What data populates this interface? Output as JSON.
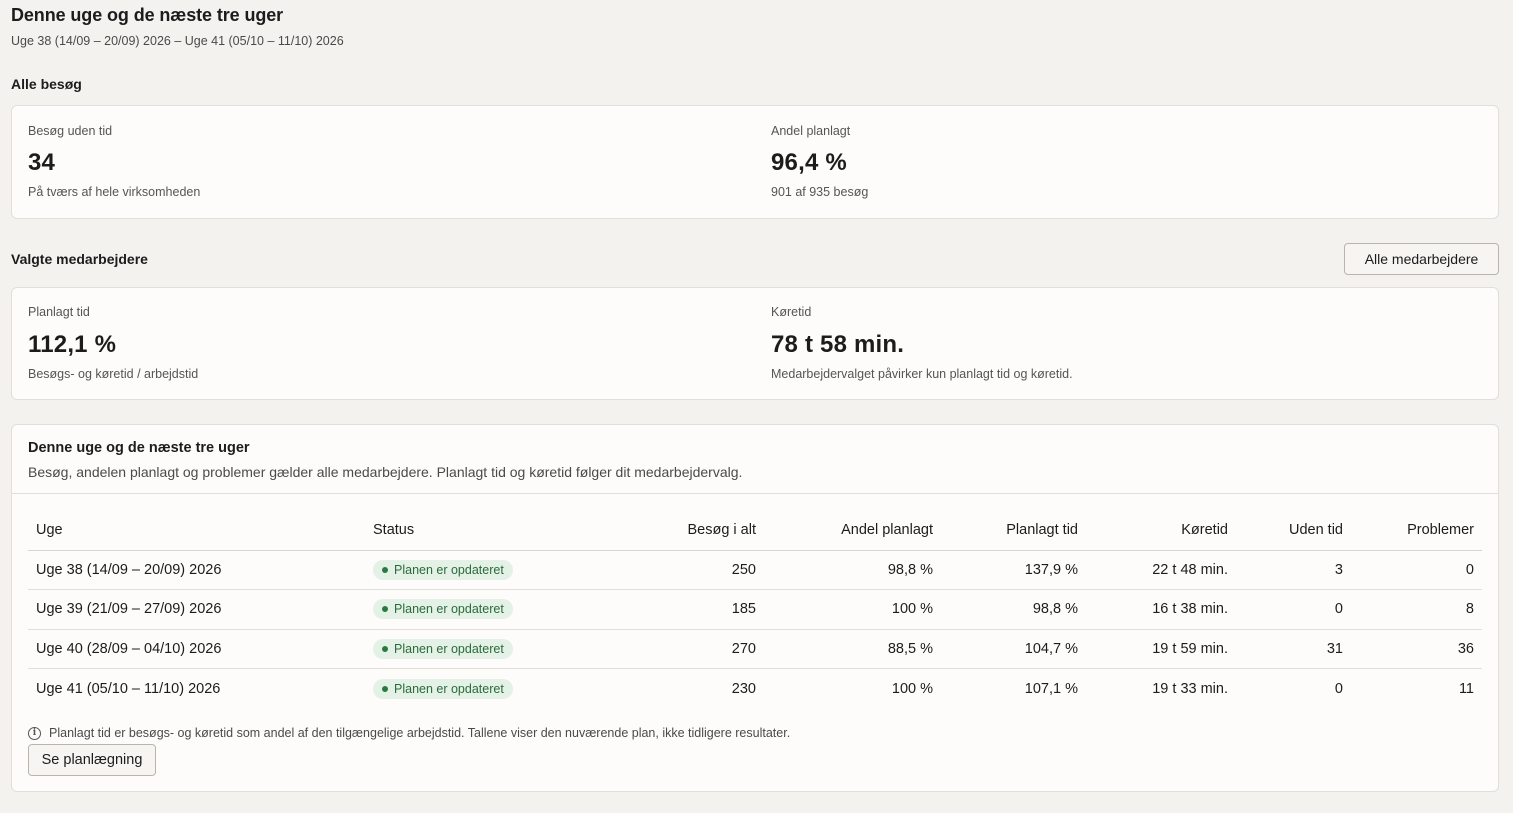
{
  "header": {
    "title": "Denne uge og de næste tre uger",
    "subtitle": "Uge 38 (14/09 – 20/09) 2026 – Uge 41 (05/10 – 11/10) 2026"
  },
  "all_visits": {
    "heading": "Alle besøg",
    "stats": [
      {
        "label": "Besøg uden tid",
        "value": "34",
        "note": "På tværs af hele virksomheden"
      },
      {
        "label": "Andel planlagt",
        "value": "96,4 %",
        "note": "901 af 935 besøg"
      }
    ]
  },
  "selected_employees": {
    "heading": "Valgte medarbejdere",
    "button_label": "Alle medarbejdere",
    "stats": [
      {
        "label": "Planlagt tid",
        "value": "112,1 %",
        "note": "Besøgs- og køretid / arbejdstid"
      },
      {
        "label": "Køretid",
        "value": "78 t 58 min.",
        "note": "Medarbejdervalget påvirker kun planlagt tid og køretid."
      }
    ]
  },
  "weeks_table": {
    "title": "Denne uge og de næste tre uger",
    "description": "Besøg, andelen planlagt og problemer gælder alle medarbejdere. Planlagt tid og køretid følger dit medarbejdervalg.",
    "columns": [
      "Uge",
      "Status",
      "Besøg i alt",
      "Andel planlagt",
      "Planlagt tid",
      "Køretid",
      "Uden tid",
      "Problemer"
    ],
    "rows": [
      {
        "week": "Uge 38 (14/09 – 20/09) 2026",
        "status": "Planen er opdateret",
        "visits": "250",
        "share": "98,8 %",
        "planned": "137,9 %",
        "driving": "22 t 48 min.",
        "no_time": "3",
        "problems": "0"
      },
      {
        "week": "Uge 39 (21/09 – 27/09) 2026",
        "status": "Planen er opdateret",
        "visits": "185",
        "share": "100 %",
        "planned": "98,8 %",
        "driving": "16 t 38 min.",
        "no_time": "0",
        "problems": "8"
      },
      {
        "week": "Uge 40 (28/09 – 04/10) 2026",
        "status": "Planen er opdateret",
        "visits": "270",
        "share": "88,5 %",
        "planned": "104,7 %",
        "driving": "19 t 59 min.",
        "no_time": "31",
        "problems": "36"
      },
      {
        "week": "Uge 41 (05/10 – 11/10) 2026",
        "status": "Planen er opdateret",
        "visits": "230",
        "share": "100 %",
        "planned": "107,1 %",
        "driving": "19 t 33 min.",
        "no_time": "0",
        "problems": "11"
      }
    ],
    "info_icon": "info-circle-icon",
    "info_text": "Planlagt tid er besøgs- og køretid som andel af den tilgængelige arbejdstid. Tallene viser den nuværende plan, ikke tidligere resultater.",
    "button_label": "Se planlægning"
  },
  "colors": {
    "background": "#f4f2ee",
    "card": "#fdfcfb",
    "badge_bg": "#e4f1e6",
    "badge_text": "#2a6b3a"
  }
}
